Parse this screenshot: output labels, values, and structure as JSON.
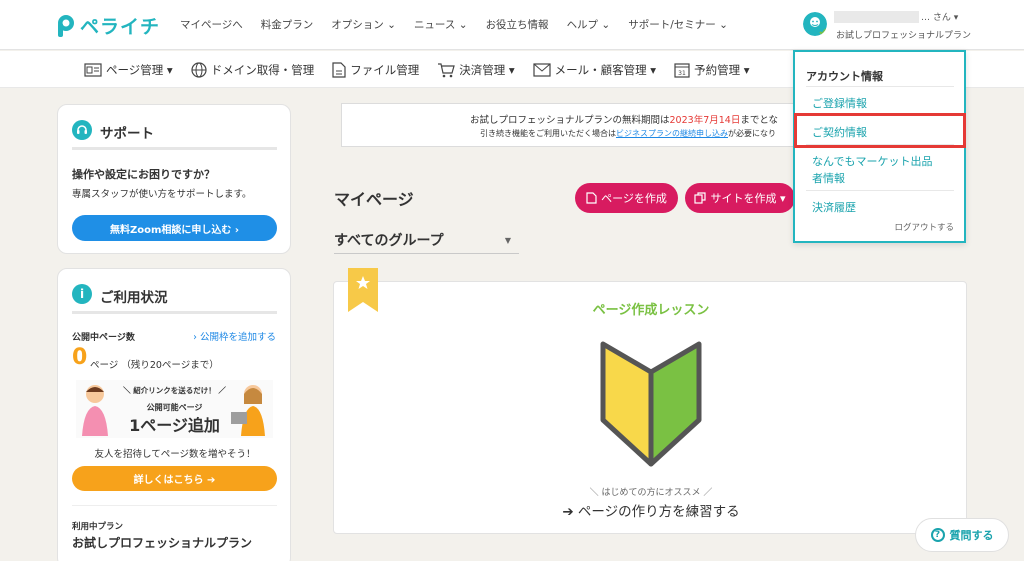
{
  "app": {
    "logo_text": "ペライチ"
  },
  "topnav": {
    "items": [
      "マイページへ",
      "料金プラン",
      "オプション ⌄",
      "ニュース ⌄",
      "お役立ち情報",
      "ヘルプ ⌄",
      "サポート/セミナー ⌄"
    ]
  },
  "user": {
    "suffix": "… さん ▾",
    "plan": "お試しプロフェッショナルプラン"
  },
  "subnav": {
    "items": [
      {
        "label": "ページ管理 ▾",
        "icon": "page-manage-icon"
      },
      {
        "label": "ドメイン取得・管理",
        "icon": "globe-icon"
      },
      {
        "label": "ファイル管理",
        "icon": "file-icon"
      },
      {
        "label": "決済管理 ▾",
        "icon": "cart-icon"
      },
      {
        "label": "メール・顧客管理 ▾",
        "icon": "mail-icon"
      },
      {
        "label": "予約管理 ▾",
        "icon": "calendar-icon"
      }
    ]
  },
  "support_card": {
    "title": "サポート",
    "question": "操作や設定にお困りですか？",
    "desc": "専属スタッフが使い方をサポートします。",
    "button": "無料Zoom相談に申し込む ›"
  },
  "usage_card": {
    "title": "ご利用状況",
    "published_label": "公開中ページ数",
    "add_link": "› 公開枠を追加する",
    "count": "0",
    "count_unit": "ページ （残り20ページまで）",
    "banner_l1": "＼ 紹介リンクを送るだけ！ ／",
    "banner_l2": "公開可能ページ",
    "banner_l3": "1ページ追加",
    "invite_text": "友人を招待してページ数を増やそう！",
    "details_button": "詳しくはこちら ➔",
    "plan_label": "利用中プラン",
    "plan_name": "お試しプロフェッショナルプラン"
  },
  "notice": {
    "line1_pre": "お試しプロフェッショナルプランの無料期間は",
    "line1_date": "2023年7月14日",
    "line1_post": "までとな",
    "line2_pre": "引き続き機能をご利用いただく場合は",
    "line2_link": "ビジネスプランの継続申し込み",
    "line2_post": "が必要になり"
  },
  "main": {
    "title": "マイページ",
    "create_page_button": "ページを作成",
    "create_site_button": "サイトを作成 ▾",
    "group_select": "すべてのグループ",
    "lesson_title": "ページ作成レッスン",
    "lesson_sub": "＼ はじめての方にオススメ ／",
    "lesson_link": "➔ ページの作り方を練習する"
  },
  "dropdown": {
    "heading": "アカウント情報",
    "items": [
      "ご登録情報",
      "ご契約情報",
      "なんでもマーケット出品",
      "者情報",
      "決済履歴"
    ],
    "logout": "ログアウトする"
  },
  "help_button": "質問する",
  "colors": {
    "brand": "#23b5bf",
    "pink": "#d81b60",
    "blue": "#1f8fe6",
    "orange": "#f7a21b",
    "highlight": "#e53935",
    "lesson_green": "#7ac143"
  }
}
